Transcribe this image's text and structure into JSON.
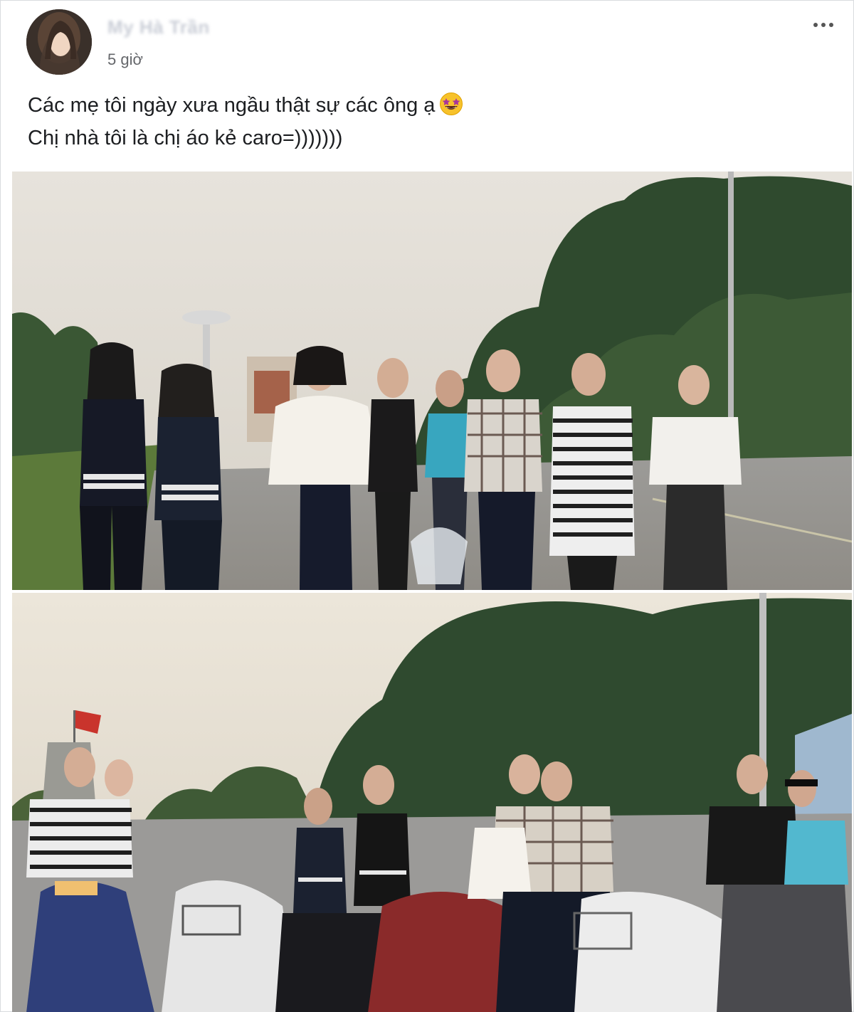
{
  "post": {
    "author": "My Hà Trần",
    "timestamp": "5 giờ",
    "text_lines": [
      "Các mẹ tôi ngày xưa ngầu thật sự các ông ạ",
      "Chị nhà tôi là chị áo kẻ caro=)))))))"
    ],
    "emoji": "star-struck-emoji",
    "more_icon": "more-options-icon"
  },
  "photos": [
    {
      "name": "photo-group-walking",
      "description_icon": "photo"
    },
    {
      "name": "photo-group-motorbikes",
      "description_icon": "photo"
    }
  ],
  "colors": {
    "text": "#1c1e21",
    "secondary_text": "#65676b",
    "border": "#d9dbdf"
  }
}
